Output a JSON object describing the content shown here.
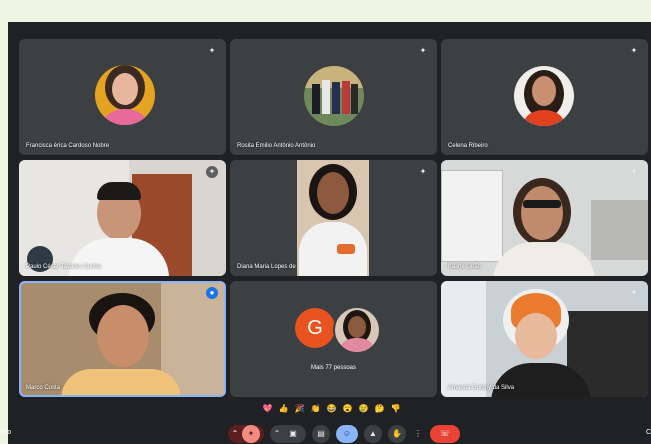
{
  "participants": [
    {
      "name": "Francisca érica Cardoso Nobre"
    },
    {
      "name": "Rosita Emilio Antônio Antônio"
    },
    {
      "name": "Celena Ribeiro"
    },
    {
      "name": "Paulo César Tavares Cunha"
    },
    {
      "name": "Diana Maria Lopes de"
    },
    {
      "name": "Kaline Girão"
    },
    {
      "name": "Marco Costa"
    },
    {
      "name": "Amanda Guidny da Silva"
    }
  ],
  "others": {
    "initial": "G",
    "label": "Mais 77 pessoas"
  },
  "reactions": [
    "💖",
    "👍",
    "🎉",
    "👏",
    "😂",
    "😮",
    "😢",
    "🤔",
    "👎"
  ],
  "controls": {
    "left_label": "nvo",
    "right_label": "C"
  }
}
